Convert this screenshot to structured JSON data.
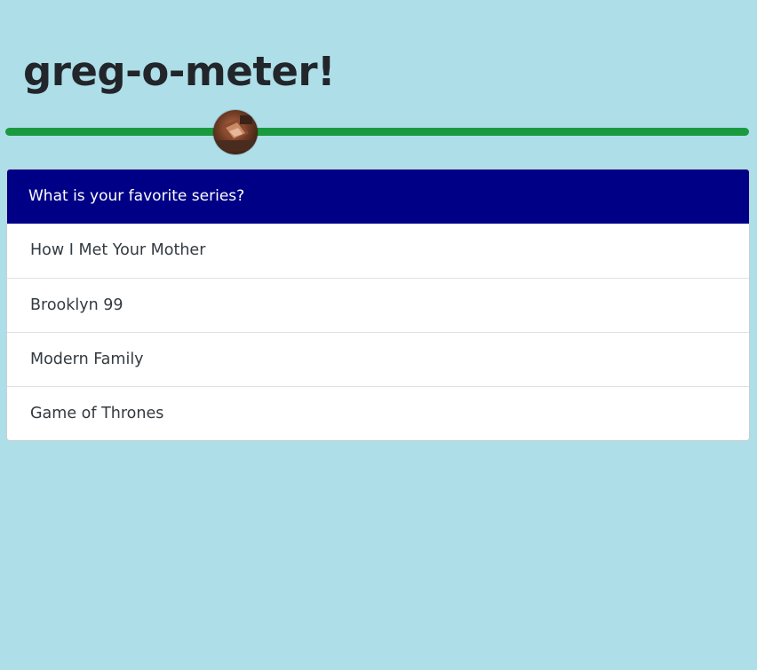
{
  "app": {
    "title": "greg-o-meter!"
  },
  "meter": {
    "level_percent": 31,
    "track_color": "#1a9a3f",
    "thumb_icon": "greg-avatar-icon"
  },
  "question": {
    "prompt": "What is your favorite series?",
    "header_color": "#000087",
    "options": [
      "How I Met Your Mother",
      "Brooklyn 99",
      "Modern Family",
      "Game of Thrones"
    ]
  },
  "colors": {
    "background": "#aedfe8"
  }
}
